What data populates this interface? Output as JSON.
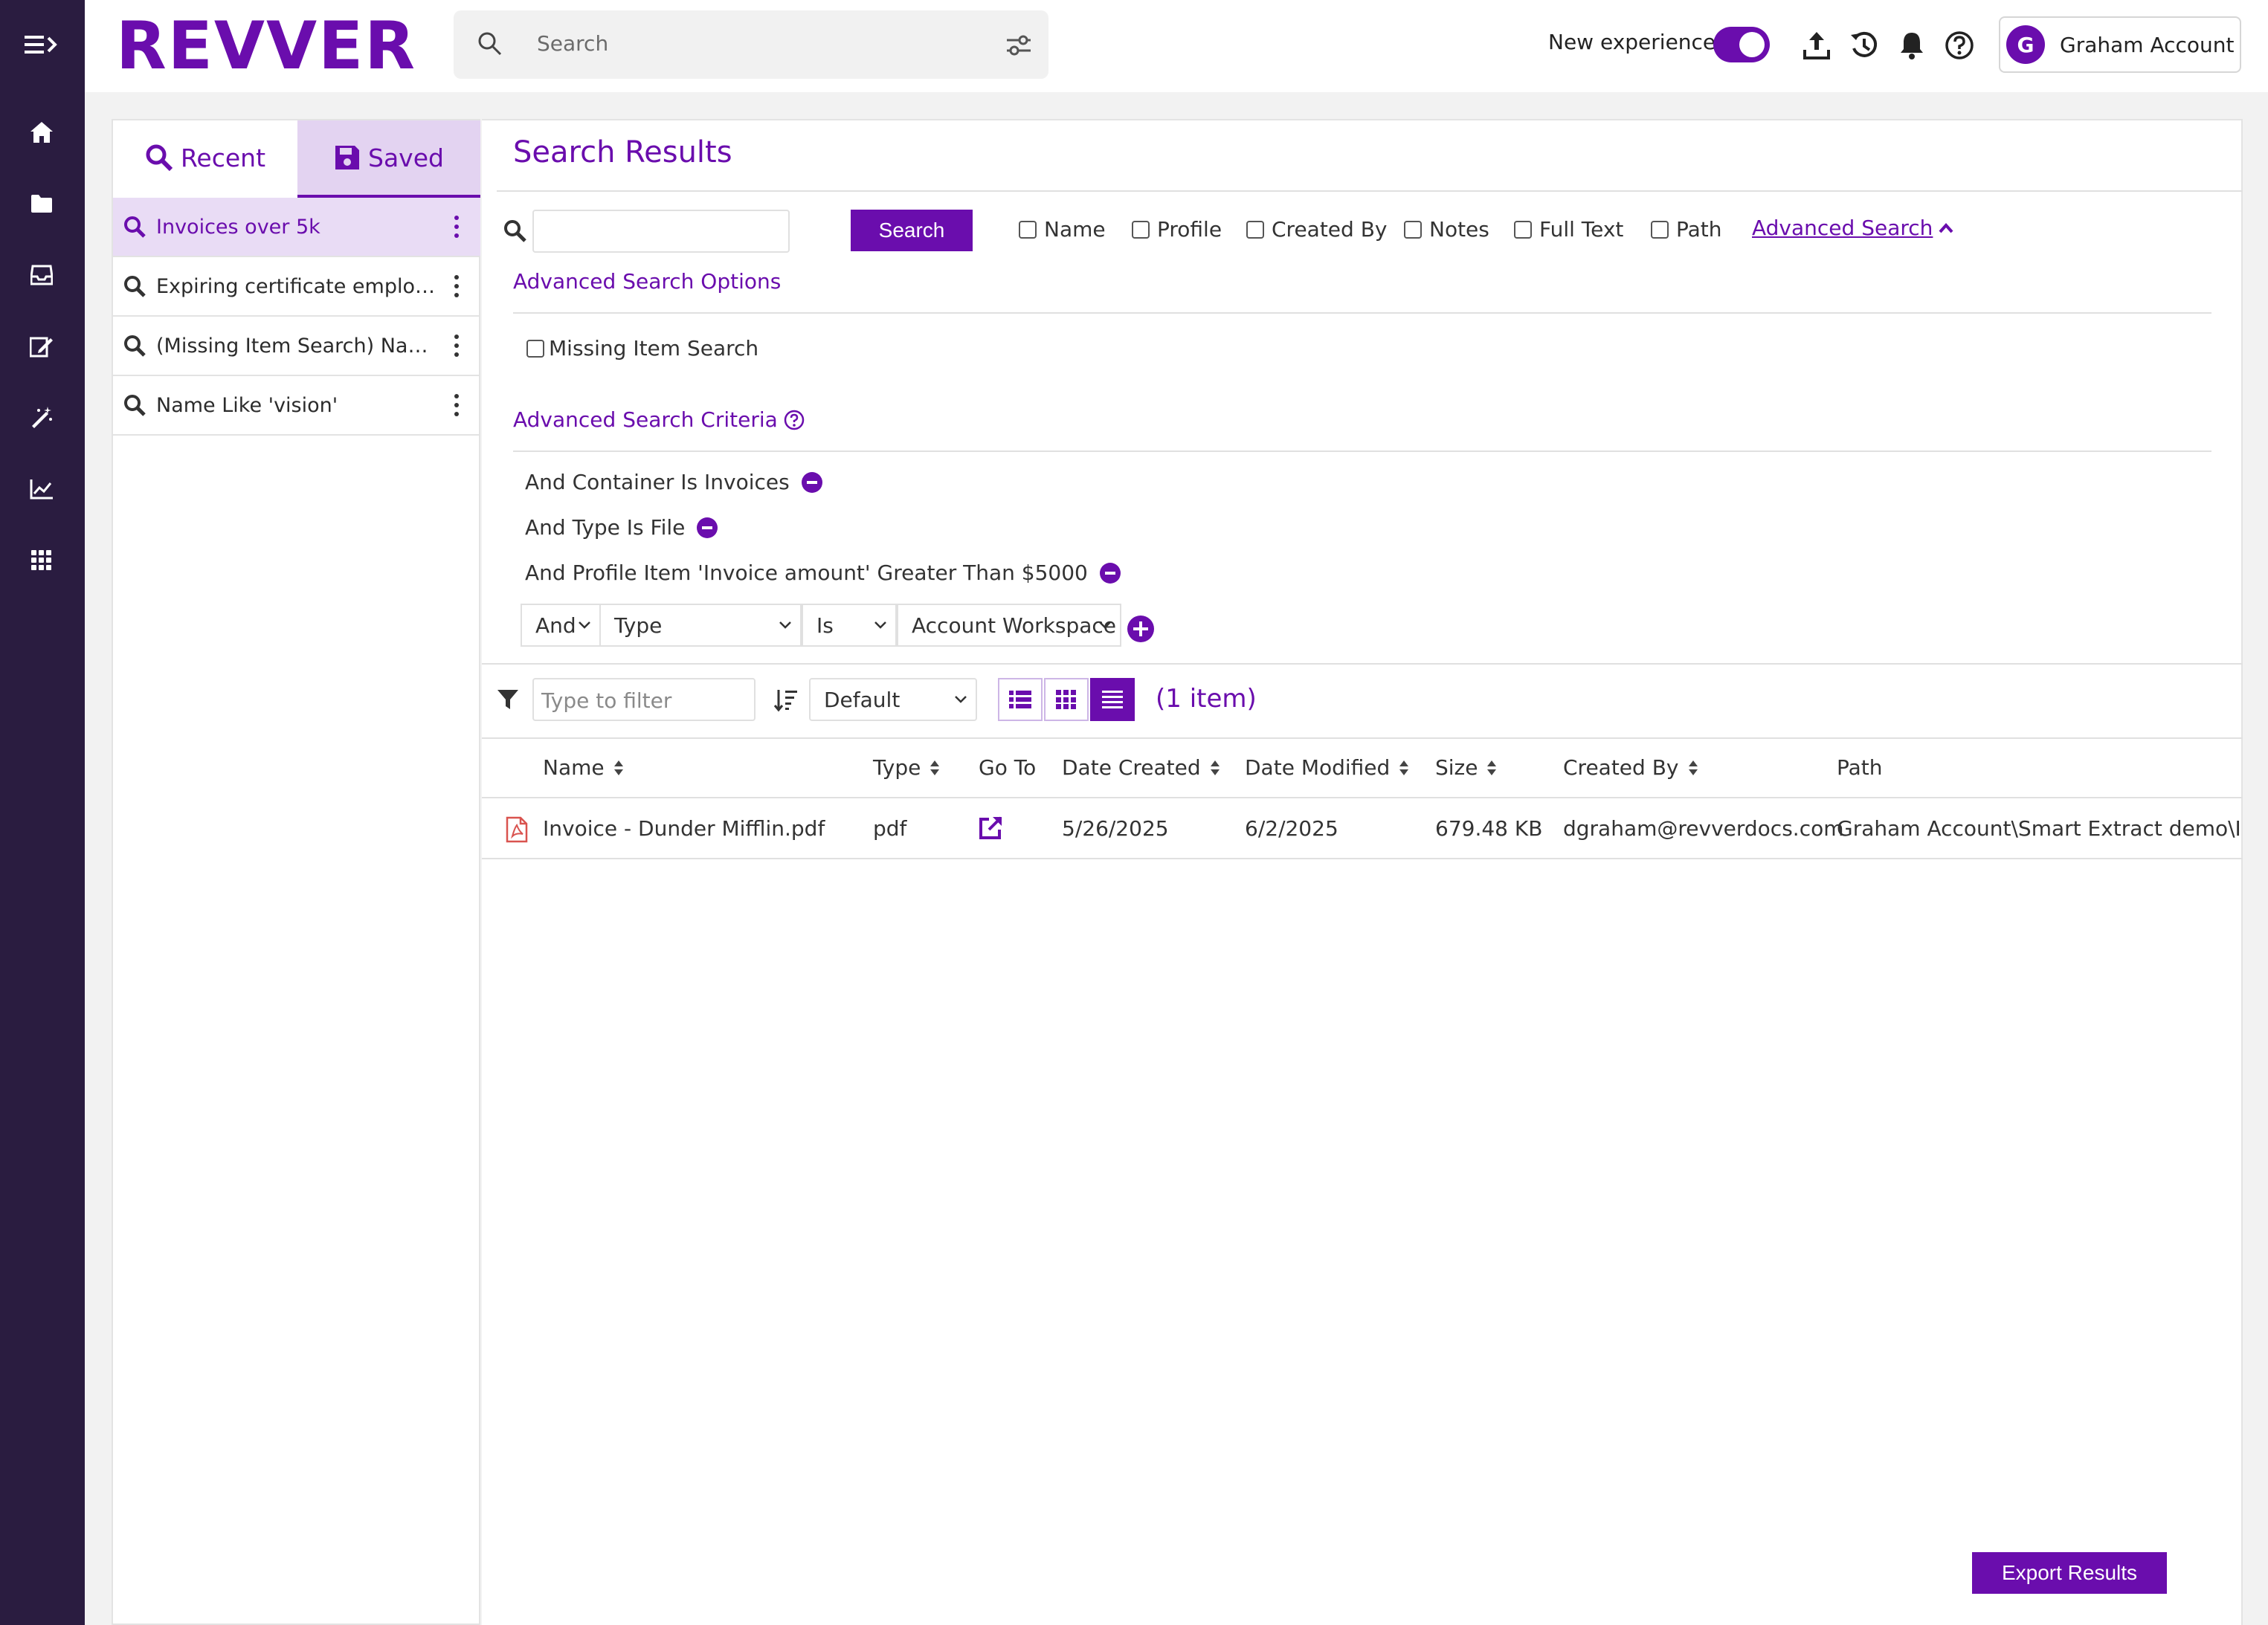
{
  "app": {
    "logo_text": "REVVER",
    "search_placeholder": "Search",
    "new_experience_label": "New experience",
    "new_experience_on": true,
    "account": {
      "avatar_letter": "G",
      "name": "Graham Account"
    },
    "brand_color": "#6a0dad",
    "rail_color": "#2a1c40"
  },
  "rail": {
    "items": [
      "menu-expand-icon",
      "home-icon",
      "folder-icon",
      "inbox-icon",
      "sign-icon",
      "magic-wand-icon",
      "chart-icon",
      "apps-grid-icon"
    ]
  },
  "top_icons": [
    "upload-icon",
    "history-icon",
    "bell-icon",
    "help-icon"
  ],
  "saved_panel": {
    "tabs": [
      {
        "label": "Recent",
        "icon": "search-icon",
        "active": false
      },
      {
        "label": "Saved",
        "icon": "save-icon",
        "active": true
      }
    ],
    "items": [
      {
        "label": "Invoices over 5k",
        "active": true
      },
      {
        "label": "Expiring certificate employe...",
        "active": false
      },
      {
        "label": "(Missing Item Search) Name...",
        "active": false
      },
      {
        "label": "Name Like 'vision'",
        "active": false
      }
    ]
  },
  "main": {
    "title": "Search Results",
    "search": {
      "query": "",
      "button": "Search",
      "checkboxes": [
        {
          "label": "Name",
          "checked": false
        },
        {
          "label": "Profile",
          "checked": false
        },
        {
          "label": "Created By",
          "checked": false
        },
        {
          "label": "Notes",
          "checked": false
        },
        {
          "label": "Full Text",
          "checked": false
        },
        {
          "label": "Path",
          "checked": false
        }
      ],
      "advanced_link": "Advanced Search"
    },
    "advanced_options": {
      "heading": "Advanced Search Options",
      "missing_item_label": "Missing Item Search",
      "missing_item_checked": false
    },
    "criteria": {
      "heading": "Advanced Search Criteria",
      "items": [
        "And Container Is Invoices",
        "And Type Is File",
        "And Profile Item 'Invoice amount' Greater Than $5000"
      ],
      "builder": {
        "conjunction": "And",
        "field": "Type",
        "operator": "Is",
        "value": "Account Workspace"
      }
    },
    "results": {
      "filter_placeholder": "Type to filter",
      "sort_value": "Default",
      "count": "(1 item)",
      "columns": [
        "Name",
        "Type",
        "Go To",
        "Date Created",
        "Date Modified",
        "Size",
        "Created By",
        "Path"
      ],
      "rows": [
        {
          "name": "Invoice - Dunder Mifflin.pdf",
          "type": "pdf",
          "date_created": "5/26/2025",
          "date_modified": "6/2/2025",
          "size": "679.48 KB",
          "created_by": "dgraham@revverdocs.com",
          "path": "Graham Account\\Smart Extract demo\\Invoice"
        }
      ]
    },
    "export_button": "Export Results"
  }
}
